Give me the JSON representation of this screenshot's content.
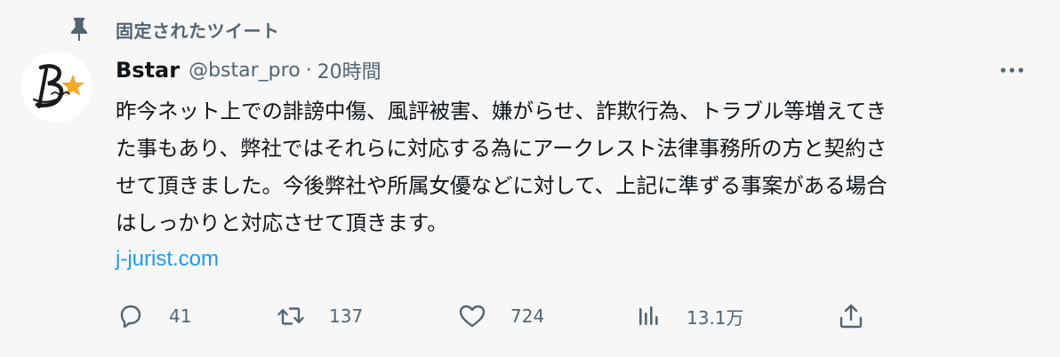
{
  "pinned": {
    "label": "固定されたツイート",
    "icon": "pin-icon"
  },
  "author": {
    "display_name": "Bstar",
    "handle": "@bstar_pro",
    "separator": "·",
    "time": "20時間"
  },
  "tweet": {
    "lines": [
      "昨今ネット上での誹謗中傷、風評被害、嫌がらせ、詐欺行為、トラブル等増えてき",
      "た事もあり、弊社ではそれらに対応する為にアークレスト法律事務所の方と契約さ",
      "せて頂きました。今後弊社や所属女優などに対して、上記に準ずる事案がある場合",
      "はしっかりと対応させて頂きます。"
    ],
    "link": "j-jurist.com"
  },
  "actions": {
    "reply": {
      "icon": "reply-icon",
      "count": "41"
    },
    "retweet": {
      "icon": "retweet-icon",
      "count": "137"
    },
    "like": {
      "icon": "heart-icon",
      "count": "724"
    },
    "views": {
      "icon": "views-icon",
      "count": "13.1万"
    },
    "share": {
      "icon": "share-icon"
    }
  },
  "colors": {
    "background": "#f7f7f7",
    "text": "#0f1419",
    "secondary": "#536471",
    "link": "#1d9bf0",
    "avatar_star": "#f5a623"
  }
}
